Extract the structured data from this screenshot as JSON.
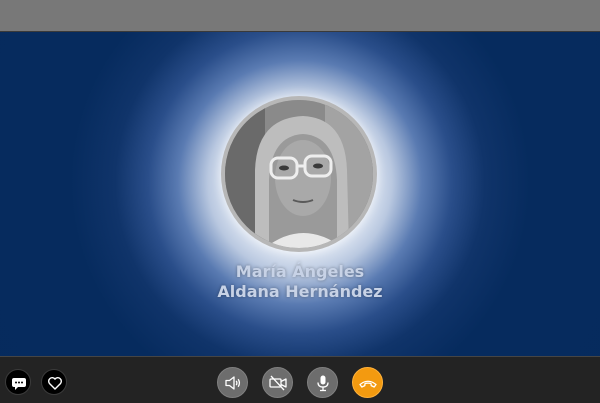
{
  "call": {
    "caller_name_line1": "María Ángeles",
    "caller_name_line2": "Aldana Hernández"
  },
  "left_actions": [
    {
      "icon": "chat-icon"
    },
    {
      "icon": "heart-icon"
    }
  ],
  "controls": [
    {
      "icon": "speaker-icon"
    },
    {
      "icon": "video-off-icon"
    },
    {
      "icon": "microphone-icon"
    },
    {
      "icon": "end-call-icon"
    }
  ],
  "colors": {
    "stage_background": "#052a5c",
    "end_call_button": "#f39a10",
    "control_button": "#6d6d6d",
    "caller_name_text": "#c7d2e6",
    "bottom_bar": "#232323"
  }
}
